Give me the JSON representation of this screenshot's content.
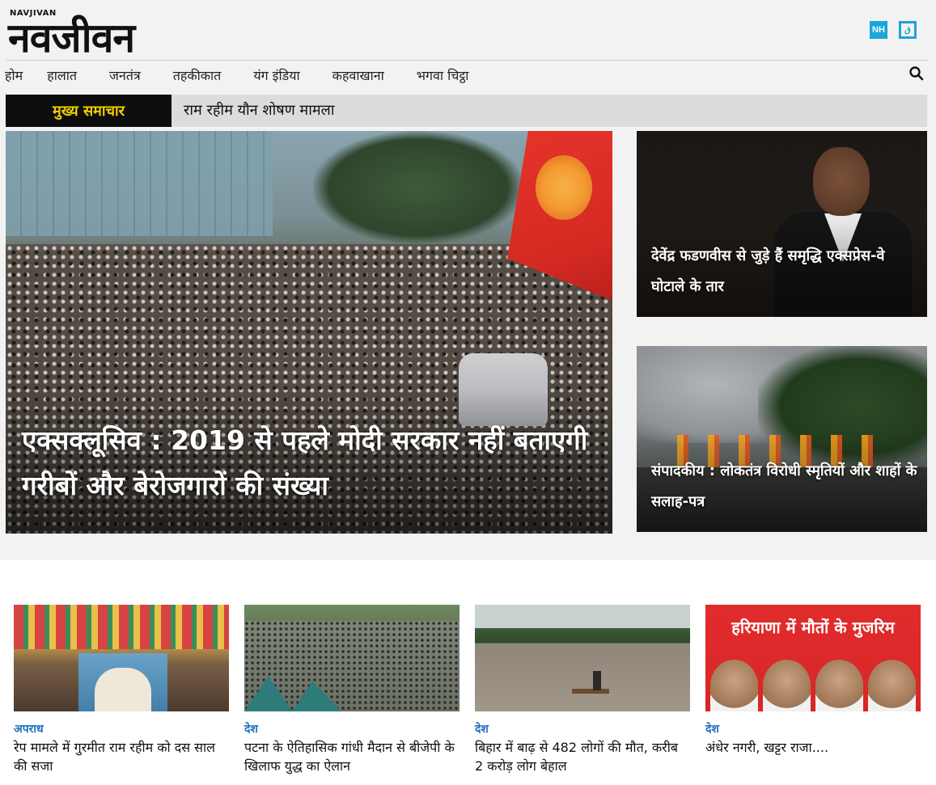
{
  "header": {
    "logo_small": "NAVJIVAN",
    "logo_main": "नवजीवन",
    "brand_icons": [
      {
        "label": "NH",
        "icon": "nh-icon"
      },
      {
        "label": "ق",
        "icon": "qaumi-icon"
      }
    ]
  },
  "nav": {
    "items": [
      "होम",
      "हालात",
      "जनतंत्र",
      "तहकीकात",
      "यंग इंडिया",
      "कहवाखाना",
      "भगवा चिट्ठा"
    ],
    "search_icon": "search-icon"
  },
  "ticker": {
    "label": "मुख्य समाचार",
    "text": "राम रहीम यौन शोषण मामला"
  },
  "hero": {
    "title": "एक्सक्लूसिव : 2019 से पहले मोदी सरकार नहीं बताएगी गरीबों और बेरोजगारों की संख्या"
  },
  "side_stories": [
    {
      "title": "देवेंद्र फडणवीस से जुड़े हैं समृद्धि एक्सप्रेस-वे घोटाले के तार"
    },
    {
      "title": "संपादकीय : लोकतंत्र विरोधी स्मृतियों और शाहों के सलाह-पत्र"
    }
  ],
  "news_cards": [
    {
      "category": "अपराध",
      "title": "रेप मामले में गुरमीत राम रहीम को दस साल की सजा"
    },
    {
      "category": "देश",
      "title": "पटना के ऐतिहासिक गांधी मैदान से बीजेपी के खिलाफ युद्ध का ऐलान"
    },
    {
      "category": "देश",
      "title": "बिहार में बाढ़ से 482 लोगों की मौत, करीब 2 करोड़ लोग बेहाल"
    },
    {
      "category": "देश",
      "title": "अंधेर नगरी, खट्टर राजा....",
      "image_text": "हरियाणा में मौतों के मुजरिम"
    }
  ],
  "colors": {
    "accent_blue": "#1aa6d9",
    "ticker_label_text": "#f0d000",
    "category_blue": "#1f6fc1"
  }
}
